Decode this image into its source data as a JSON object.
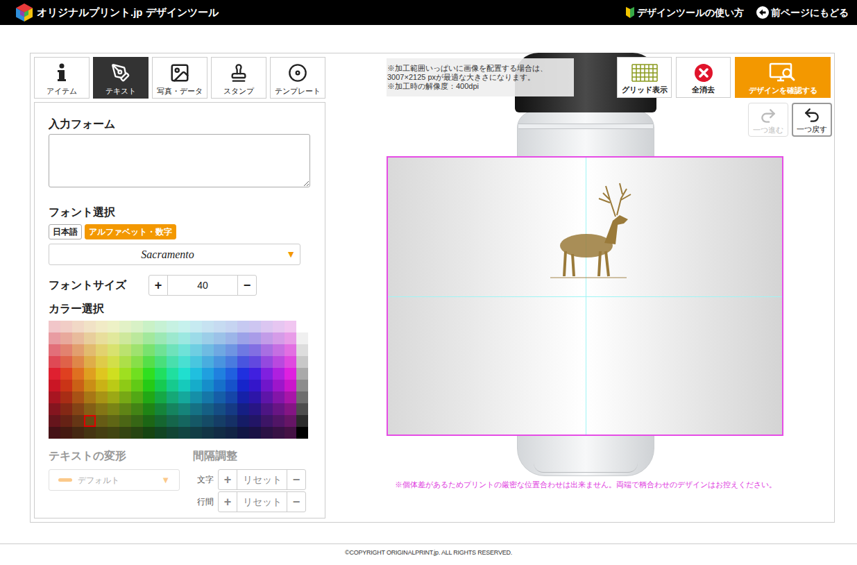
{
  "header": {
    "logo": "オリジナルプリント.jp デザインツール",
    "links": [
      {
        "label": "デザインツールの使い方"
      },
      {
        "label": "前ページにもどる"
      }
    ]
  },
  "tabs": [
    {
      "label": "アイテム",
      "selected": false
    },
    {
      "label": "テキスト",
      "selected": true
    },
    {
      "label": "写真・データ",
      "selected": false
    },
    {
      "label": "スタンプ",
      "selected": false
    },
    {
      "label": "テンプレート",
      "selected": false
    }
  ],
  "text_panel": {
    "input_form": {
      "label": "入力フォーム",
      "value": ""
    },
    "font": {
      "label": "フォント選択",
      "types": [
        {
          "label": "日本語",
          "selected": false
        },
        {
          "label": "アルファベット・数字",
          "selected": true
        }
      ],
      "selected_font": "Sacramento",
      "arrow": "▼"
    },
    "font_size": {
      "label": "フォントサイズ",
      "increase": "+",
      "value": "40",
      "decrease": "−"
    },
    "color": {
      "label": "カラー選択",
      "hues": [
        355,
        10,
        25,
        40,
        52,
        65,
        80,
        95,
        115,
        140,
        160,
        175,
        190,
        200,
        210,
        220,
        235,
        250,
        270,
        285,
        300
      ],
      "tones": [
        {
          "saturation": 60,
          "lightness": 86
        },
        {
          "saturation": 62,
          "lightness": 76
        },
        {
          "saturation": 66,
          "lightness": 66
        },
        {
          "saturation": 70,
          "lightness": 58
        },
        {
          "saturation": 75,
          "lightness": 50
        },
        {
          "saturation": 80,
          "lightness": 44
        },
        {
          "saturation": 78,
          "lightness": 37
        },
        {
          "saturation": 72,
          "lightness": 30
        },
        {
          "saturation": 66,
          "lightness": 24
        },
        {
          "saturation": 60,
          "lightness": 17
        }
      ],
      "grays": [
        "#ffffff",
        "#f0f0f0",
        "#dddddd",
        "#c8c8c8",
        "#aaaaaa",
        "#8c8c8c",
        "#6e6e6e",
        "#4d4d4d",
        "#2b2b2b",
        "#000000"
      ],
      "selected": {
        "row": 8,
        "column": 3
      }
    },
    "transform": {
      "label": "テキストの変形",
      "value": "デフォルト",
      "arrow": "▼",
      "disabled": true
    },
    "spacing": {
      "label": "間隔調整",
      "disabled": true,
      "rows": [
        {
          "label": "文字",
          "increase": "+",
          "reset": "リセット",
          "decrease": "−"
        },
        {
          "label": "行間",
          "increase": "+",
          "reset": "リセット",
          "decrease": "−"
        }
      ]
    }
  },
  "canvas": {
    "notice": [
      "※加工範囲いっぱいに画像を配置する場合は、",
      "3007×2125 pxが最適な大きさになります。",
      "※加工時の解像度：400dpi"
    ],
    "toolbar": [
      {
        "label": "グリッド表示",
        "kind": "grid"
      },
      {
        "label": "全消去",
        "kind": "clear"
      },
      {
        "label": "デザインを確認する",
        "kind": "confirm"
      }
    ],
    "history": [
      {
        "label": "一つ進む",
        "kind": "redo",
        "disabled": true
      },
      {
        "label": "一つ戻す",
        "kind": "undo",
        "disabled": false
      }
    ],
    "guides_visible": true,
    "warning": "※個体差があるためプリントの厳密な位置合わせは出来ません。両端で柄合わせのデザインはお控えください。"
  },
  "footer": {
    "copyright": "©COPYRIGHT ORIGINALPRINT.jp. ALL RIGHTS RESERVED."
  }
}
